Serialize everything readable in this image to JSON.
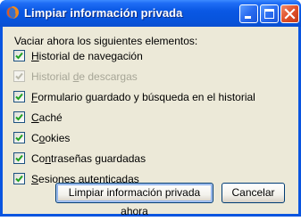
{
  "window": {
    "title": "Limpiar información privada"
  },
  "dialog": {
    "intro": "Vaciar ahora los siguientes elementos:",
    "items": [
      {
        "pre": "",
        "key": "H",
        "post": "istorial de navegación",
        "checked": true,
        "enabled": true
      },
      {
        "pre": "Historial ",
        "key": "d",
        "post": "e descargas",
        "checked": true,
        "enabled": false
      },
      {
        "pre": "",
        "key": "F",
        "post": "ormulario guardado y búsqueda en el historial",
        "checked": true,
        "enabled": true
      },
      {
        "pre": "",
        "key": "C",
        "post": "aché",
        "checked": true,
        "enabled": true
      },
      {
        "pre": "C",
        "key": "o",
        "post": "okies",
        "checked": true,
        "enabled": true
      },
      {
        "pre": "Co",
        "key": "n",
        "post": "traseñas guardadas",
        "checked": true,
        "enabled": true
      },
      {
        "pre": "",
        "key": "S",
        "post": "esiones autenticadas",
        "checked": true,
        "enabled": true
      }
    ],
    "buttons": {
      "clear": "Limpiar información privada ahora",
      "cancel": "Cancelar"
    }
  },
  "colors": {
    "titlebar": "#0a58e4",
    "client": "#ece9d8",
    "check": "#21a121",
    "close_button": "#e0502a"
  }
}
